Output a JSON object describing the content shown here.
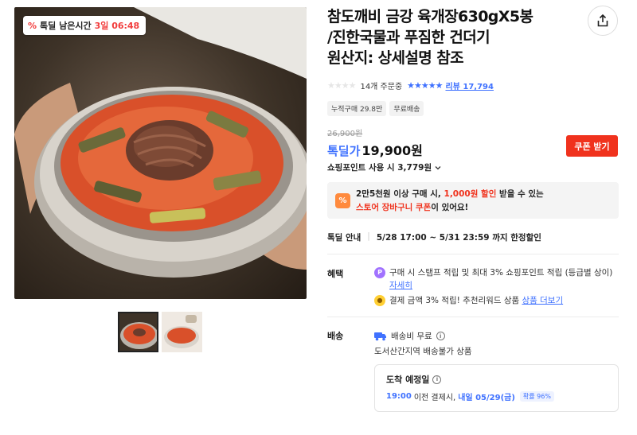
{
  "badge": {
    "label": "톡딜 남은시간",
    "remaining": "3일 06:48",
    "icon": "discount-percent-icon"
  },
  "product": {
    "title_lines": [
      "참도깨비 금강 육개장630gX5봉",
      "/진한국물과 푸짐한 건더기",
      "원산지: 상세설명 참조"
    ]
  },
  "stats": {
    "orders": "14개 주문중",
    "rating_stars": 4.5,
    "review": "리뷰 17,794"
  },
  "chips": [
    "누적구매 29.8만",
    "무료배송"
  ],
  "price": {
    "original": "26,900원",
    "sale_label": "톡딜가",
    "sale_price": "19,900원",
    "coupon_button": "쿠폰 받기",
    "points": "쇼핑포인트 사용 시 3,779원"
  },
  "promo": {
    "line1_pre": "2만5천원 이상 구매 시, ",
    "line1_red": "1,000원 할인",
    "line1_post": " 받을 수 있는",
    "line2_red": "스토어 장바구니 쿠폰",
    "line2_post": "이 있어요!"
  },
  "deal": {
    "label": "톡딜 안내",
    "period": "5/28 17:00 ~ 5/31 23:59 까지 한정할인"
  },
  "benefits": {
    "label": "혜택",
    "item1_text": "구매 시 스탬프 적립 및 최대 3% 쇼핑포인트 적립 (등급별 상이) ",
    "item1_link": "자세히",
    "item2_text": "결제 금액 3% 적립! 추천리워드 상품 ",
    "item2_link": "상품 더보기"
  },
  "shipping": {
    "label": "배송",
    "fee": "배송비 무료",
    "note": "도서산간지역 배송불가 상품",
    "arrival_title": "도착 예정일",
    "arrival_time": "19:00",
    "arrival_mid": " 이전 결제시, ",
    "arrival_date": "내일 05/29(금)",
    "probability": "확률 96%"
  },
  "colors": {
    "accent_blue": "#3f71ff",
    "accent_red": "#f0321d",
    "promo_orange": "#ff8a3d"
  }
}
